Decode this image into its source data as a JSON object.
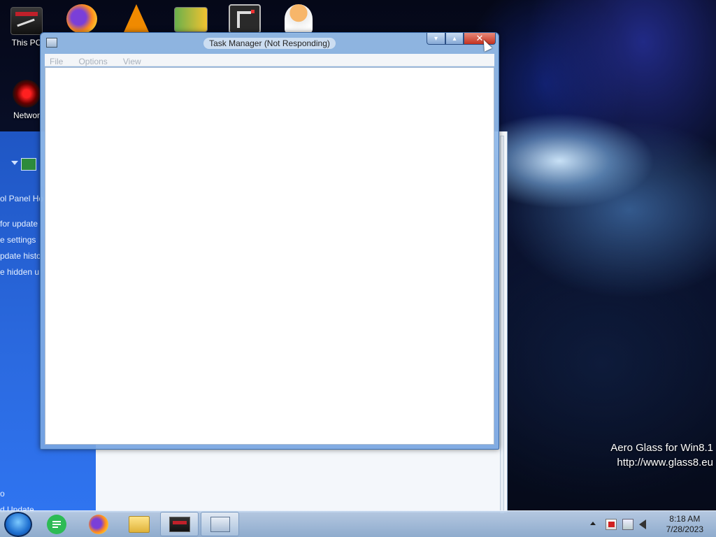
{
  "desktop": {
    "icons": [
      {
        "label": "This PC"
      },
      {
        "label": "Networ"
      },
      {
        "label": ""
      },
      {
        "label": ""
      },
      {
        "label": ""
      },
      {
        "label": ""
      },
      {
        "label": ""
      }
    ],
    "watermark": {
      "line1": "Aero Glass for Win8.1",
      "line2": "http://www.glass8.eu"
    }
  },
  "control_panel": {
    "links": [
      "ol Panel Ho",
      "for update",
      "e settings",
      "pdate histo",
      "e hidden u",
      "o",
      "d Update"
    ]
  },
  "task_manager": {
    "title": "Task Manager (Not Responding)",
    "menu": [
      "File",
      "Options",
      "View"
    ],
    "controls": {
      "minimize": "▾",
      "maximize": "▴",
      "close": "✕"
    }
  },
  "taskbar": {
    "clock": {
      "time": "8:18 AM",
      "date": "7/28/2023"
    }
  },
  "colors": {
    "close_red": "#c43220",
    "menu_text_disabled": "#a9b1bb",
    "cp_sidebar_blue": "#2b6ae0"
  }
}
